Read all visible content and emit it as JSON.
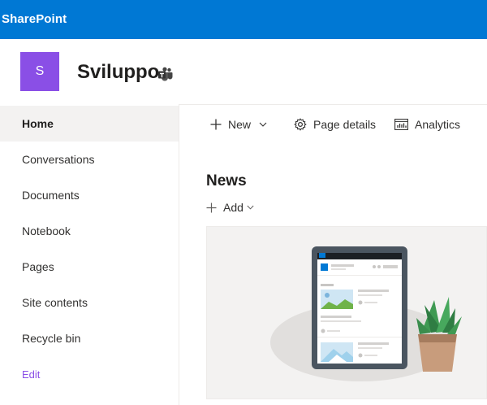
{
  "suite": {
    "brand": "SharePoint"
  },
  "site": {
    "logo_letter": "S",
    "title": "Sviluppo",
    "logo_color": "#8a4fe6"
  },
  "nav": {
    "items": [
      {
        "label": "Home",
        "active": true
      },
      {
        "label": "Conversations"
      },
      {
        "label": "Documents"
      },
      {
        "label": "Notebook"
      },
      {
        "label": "Pages"
      },
      {
        "label": "Site contents"
      },
      {
        "label": "Recycle bin"
      }
    ],
    "edit_label": "Edit"
  },
  "commands": {
    "new_label": "New",
    "page_details_label": "Page details",
    "analytics_label": "Analytics"
  },
  "news": {
    "title": "News",
    "add_label": "Add"
  },
  "colors": {
    "suite_bar": "#0078d4",
    "accent": "#8a4fe6",
    "text": "#323130"
  }
}
